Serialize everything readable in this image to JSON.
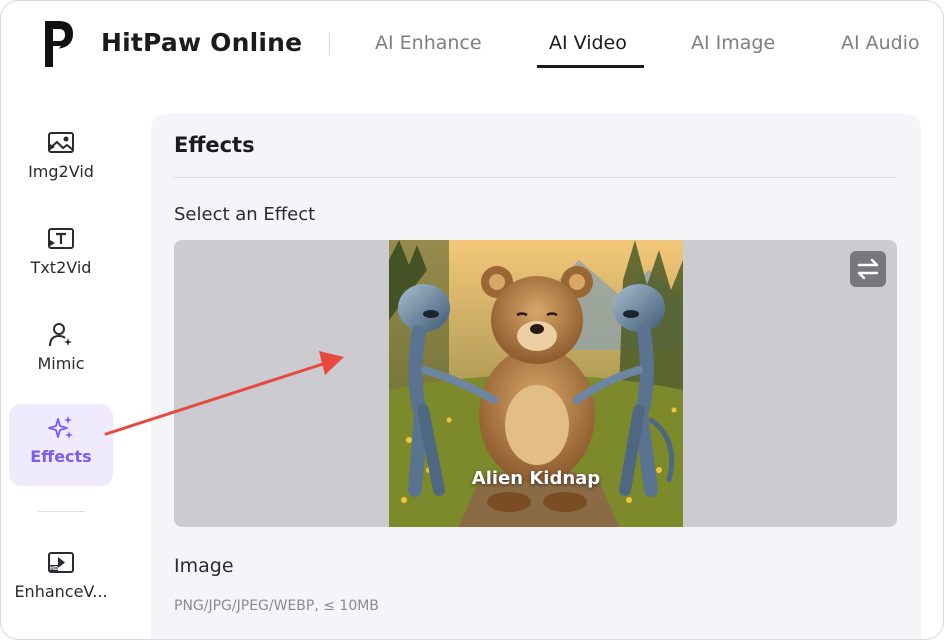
{
  "brand": {
    "name": "HitPaw Online",
    "logo_icon": "hitpaw-logo-icon"
  },
  "nav": {
    "tabs": [
      {
        "label": "AI Enhance",
        "active": false
      },
      {
        "label": "AI Video",
        "active": true
      },
      {
        "label": "AI Image",
        "active": false
      },
      {
        "label": "AI Audio",
        "active": false
      }
    ]
  },
  "sidebar": {
    "items": [
      {
        "label": "Img2Vid",
        "icon": "image-to-video-icon",
        "active": false
      },
      {
        "label": "Txt2Vid",
        "icon": "text-to-video-icon",
        "active": false
      },
      {
        "label": "Mimic",
        "icon": "user-sparkle-icon",
        "active": false
      },
      {
        "label": "Effects",
        "icon": "sparkles-icon",
        "active": true
      },
      {
        "label": "EnhanceV...",
        "icon": "hd-video-icon",
        "active": false
      }
    ]
  },
  "main": {
    "title": "Effects",
    "select_label": "Select an Effect",
    "effect": {
      "caption": "Alien Kidnap",
      "swap_icon": "swap-arrows-icon"
    },
    "image_section": {
      "label": "Image",
      "hint": "PNG/JPG/JPEG/WEBP, ≤ 10MB"
    }
  },
  "annotation": {
    "arrow_color": "#e8483f"
  },
  "colors": {
    "accent": "#7c5cf2",
    "active_bg": "#efeafd",
    "panel_bg": "#f5f5f9",
    "preview_bg": "#cbcbd0"
  }
}
